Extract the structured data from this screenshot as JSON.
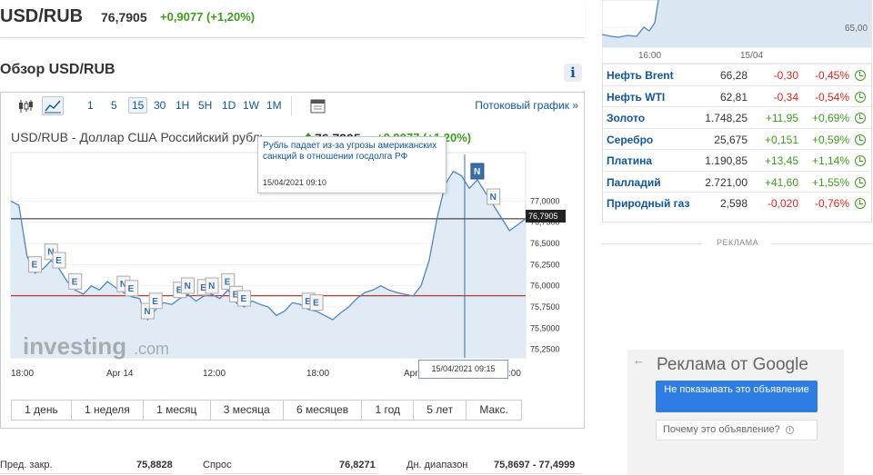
{
  "header": {
    "pair": "USD/RUB",
    "price": "76,7905",
    "change": "+0,9077 (+1,20%)"
  },
  "overview": {
    "title": "Обзор USD/RUB",
    "info_icon": "i"
  },
  "toolbar": {
    "intervals": [
      "1",
      "5",
      "15",
      "30",
      "1H",
      "5H",
      "1D",
      "1W",
      "1M"
    ],
    "selected": "15",
    "stream_link": "Потоковый график »"
  },
  "chart_header": {
    "title": "USD/RUB - Доллар США Российский рубль",
    "price": "76,7905",
    "change": "+0,9077 (+1,20%)"
  },
  "tooltip": {
    "text": "Рубль падает из-за угрозы американских санкций в отношении госдолга РФ",
    "time": "15/04/2021 09:10"
  },
  "crosshair": {
    "label": "15/04/2021 09:15",
    "price_label": "76,7905"
  },
  "chart_data": {
    "type": "line",
    "x_ticks": [
      "18:00",
      "Apr 14",
      "12:00",
      "18:00",
      "Apr",
      ":00"
    ],
    "y_ticks": [
      "77,0000",
      "76,7500",
      "76,5000",
      "76,2500",
      "76,0000",
      "75,7500",
      "75,5000",
      "75,2500"
    ],
    "ylim": [
      75.15,
      77.55
    ],
    "prev_close": 75.8828,
    "current": 76.7905,
    "values": [
      77.0,
      76.95,
      76.35,
      76.15,
      76.2,
      76.3,
      76.2,
      76.05,
      75.95,
      75.9,
      76.0,
      75.95,
      76.05,
      75.98,
      75.92,
      75.87,
      75.85,
      75.6,
      75.72,
      75.8,
      75.78,
      75.85,
      75.9,
      75.82,
      75.88,
      75.9,
      75.85,
      75.95,
      75.8,
      75.75,
      75.82,
      75.78,
      75.75,
      75.65,
      75.7,
      75.8,
      75.78,
      75.72,
      75.7,
      75.65,
      75.6,
      75.68,
      75.75,
      75.85,
      75.92,
      75.95,
      76.0,
      75.95,
      75.92,
      75.9,
      75.88,
      76.0,
      76.3,
      76.8,
      77.2,
      77.35,
      77.3,
      77.15,
      77.25,
      77.1,
      76.95,
      76.8,
      76.65,
      76.72,
      76.79
    ],
    "markers": [
      "E",
      "N",
      "E",
      "E",
      "N",
      "E",
      "N",
      "E",
      "E",
      "N",
      "E",
      "N",
      "E",
      "E",
      "E",
      "E",
      "E",
      "N",
      "N"
    ],
    "watermark": "investing",
    "watermark_suffix": ".com"
  },
  "periods": [
    "1 день",
    "1 неделя",
    "1 месяц",
    "3 месяца",
    "6 месяцев",
    "1 год",
    "5 лет",
    "Макс."
  ],
  "stats": [
    {
      "label": "Пред. закр.",
      "value": "75,8828"
    },
    {
      "label": "Спрос",
      "value": "76,8271"
    },
    {
      "label": "Дн. диапазон",
      "value": "75,8697 - 77,4999"
    }
  ],
  "mini_chart": {
    "x_ticks": [
      "16:00",
      "15/04"
    ],
    "y_tick": "65,00"
  },
  "commodities": [
    {
      "name": "Нефть Brent",
      "value": "66,28",
      "change": "-0,30",
      "percent": "-0,45%"
    },
    {
      "name": "Нефть WTI",
      "value": "62,81",
      "change": "-0,34",
      "percent": "-0,54%"
    },
    {
      "name": "Золото",
      "value": "1.748,25",
      "change": "+11,95",
      "percent": "+0,69%"
    },
    {
      "name": "Серебро",
      "value": "25,675",
      "change": "+0,151",
      "percent": "+0,59%"
    },
    {
      "name": "Платина",
      "value": "1.190,85",
      "change": "+13,45",
      "percent": "+1,14%"
    },
    {
      "name": "Палладий",
      "value": "2.721,00",
      "change": "+41,60",
      "percent": "+1,55%"
    },
    {
      "name": "Природный газ",
      "value": "2,598",
      "change": "-0,020",
      "percent": "-0,76%"
    }
  ],
  "ad": {
    "divider": "РЕКЛАМА",
    "google_label": "Реклама от Google",
    "hide_button": "Не показывать это объявление",
    "why_button": "Почему это объявление?",
    "back_arrow": "←"
  },
  "colors": {
    "positive": "#3c9d1c",
    "negative": "#e2231a",
    "link": "#1256a0"
  }
}
